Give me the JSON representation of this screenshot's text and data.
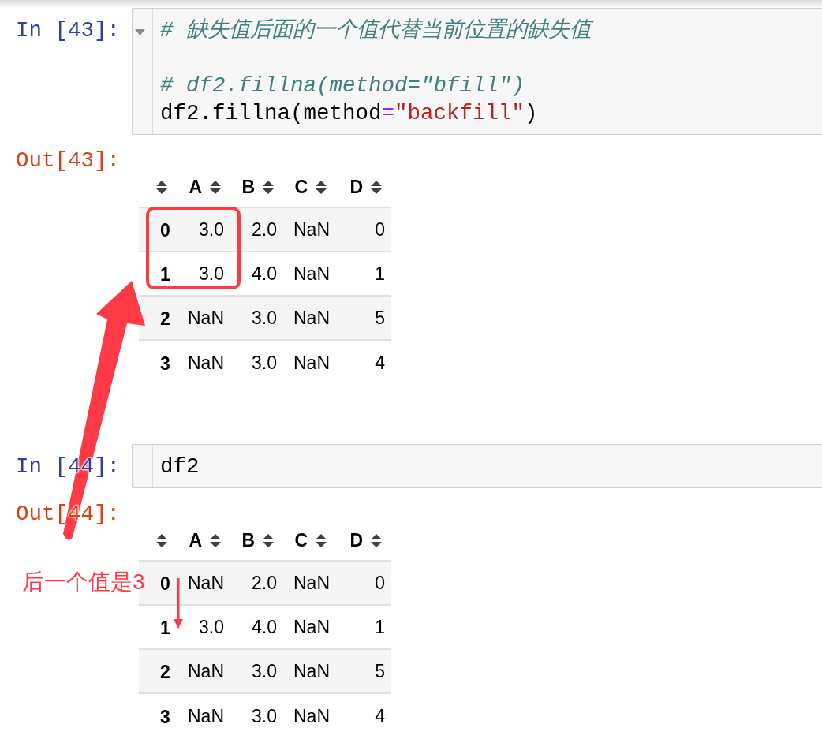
{
  "cells": [
    {
      "kind": "code",
      "prompt": "In [43]:",
      "foldable": true,
      "lines": [
        {
          "kind": "code",
          "tokens": [
            {
              "kind": "comment",
              "text": "# 缺失值后面的一个值代替当前位置的缺失值"
            }
          ]
        },
        {
          "kind": "blank"
        },
        {
          "kind": "code",
          "tokens": [
            {
              "kind": "comment",
              "text": "# df2.fillna(method=\"bfill\")"
            }
          ]
        },
        {
          "kind": "code",
          "tokens": [
            {
              "kind": "plain",
              "text": "df2.fillna(method"
            },
            {
              "kind": "operator",
              "text": "="
            },
            {
              "kind": "string",
              "text": "\"backfill\""
            },
            {
              "kind": "plain",
              "text": ")"
            }
          ]
        }
      ]
    },
    {
      "kind": "output",
      "prompt": "Out[43]:",
      "table": {
        "columns": [
          "A",
          "B",
          "C",
          "D"
        ],
        "rows": [
          {
            "index": "0",
            "cells": [
              "3.0",
              "2.0",
              "NaN",
              "0"
            ]
          },
          {
            "index": "1",
            "cells": [
              "3.0",
              "4.0",
              "NaN",
              "1"
            ]
          },
          {
            "index": "2",
            "cells": [
              "NaN",
              "3.0",
              "NaN",
              "5"
            ]
          },
          {
            "index": "3",
            "cells": [
              "NaN",
              "3.0",
              "NaN",
              "4"
            ]
          }
        ]
      }
    },
    {
      "kind": "code",
      "prompt": "In [44]:",
      "foldable": false,
      "lines": [
        {
          "kind": "code",
          "tokens": [
            {
              "kind": "plain",
              "text": "df2"
            }
          ]
        }
      ]
    },
    {
      "kind": "output",
      "prompt": "Out[44]:",
      "table": {
        "columns": [
          "A",
          "B",
          "C",
          "D"
        ],
        "rows": [
          {
            "index": "0",
            "cells": [
              "NaN",
              "2.0",
              "NaN",
              "0"
            ]
          },
          {
            "index": "1",
            "cells": [
              "3.0",
              "4.0",
              "NaN",
              "1"
            ]
          },
          {
            "index": "2",
            "cells": [
              "NaN",
              "3.0",
              "NaN",
              "5"
            ]
          },
          {
            "index": "3",
            "cells": [
              "NaN",
              "3.0",
              "NaN",
              "4"
            ]
          }
        ]
      }
    }
  ],
  "annotations": [
    {
      "kind": "box"
    },
    {
      "kind": "big_arrow"
    },
    {
      "kind": "note",
      "text": "后一个值是3"
    },
    {
      "kind": "small_arrow"
    }
  ]
}
